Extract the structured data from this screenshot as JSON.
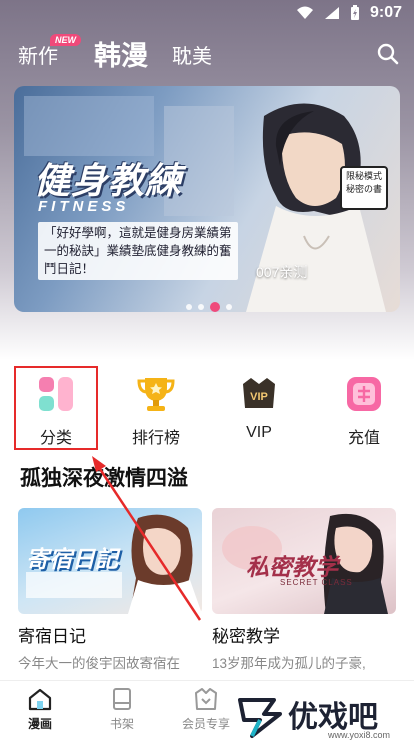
{
  "status_bar": {
    "time": "9:07"
  },
  "top_nav": {
    "tabs": [
      {
        "label": "新作",
        "active": false
      },
      {
        "label": "韩漫",
        "active": true
      },
      {
        "label": "耽美",
        "active": false
      }
    ],
    "new_badge": "NEW",
    "search_icon": "search-icon"
  },
  "banner": {
    "title": "健身教練",
    "subtitle": "FITNESS",
    "description": "「好好學啊，這就是健身房業績第一的秘訣」業績墊底健身教練的奮鬥日記！",
    "caption": "007亲测",
    "stamp": "限秘模式 秘密の書",
    "slide_count": 4,
    "active_slide": 3
  },
  "quick_entries": [
    {
      "label": "分类",
      "icon": "category-icon",
      "color": "#f57fb0"
    },
    {
      "label": "排行榜",
      "icon": "trophy-icon",
      "color": "#f5b316"
    },
    {
      "label": "VIP",
      "icon": "vip-crown-icon",
      "color": "#3a3128"
    },
    {
      "label": "充值",
      "icon": "recharge-icon",
      "color": "#f768a4"
    }
  ],
  "section": {
    "title": "孤独深夜激情四溢"
  },
  "cards": [
    {
      "title": "寄宿日记",
      "description": "今年大一的俊宇因故寄宿在",
      "cover_text": "寄宿日記"
    },
    {
      "title": "秘密教学",
      "description": "13岁那年成为孤儿的子豪,",
      "cover_text": "私密教学",
      "cover_subtext": "SECRET CLASS"
    }
  ],
  "bottom_nav": [
    {
      "label": "漫画",
      "icon": "home-icon",
      "active": true
    },
    {
      "label": "书架",
      "icon": "bookshelf-icon",
      "active": false
    },
    {
      "label": "会员专享",
      "icon": "vip-icon",
      "active": false
    }
  ],
  "watermark": {
    "text": "优戏吧",
    "url": "www.yoxi8.com"
  }
}
